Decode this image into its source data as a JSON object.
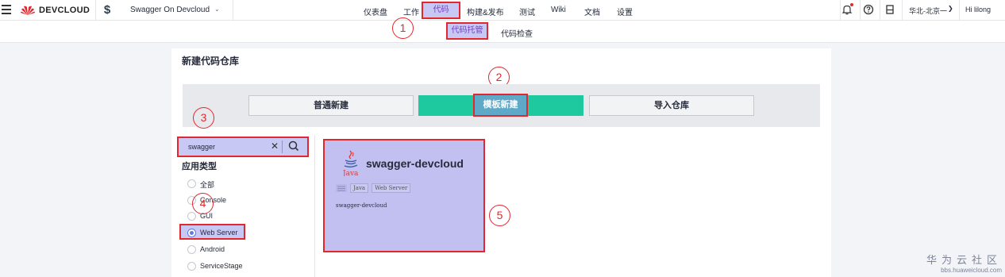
{
  "header": {
    "brand": "DEVCLOUD",
    "project": "Swagger On Devcloud",
    "nav": [
      "仪表盘",
      "工作",
      "代码",
      "构建&发布",
      "测试",
      "Wiki",
      "文档",
      "设置"
    ],
    "active_nav": "代码",
    "region": "华北-北京一",
    "user": "Hi lilong"
  },
  "subnav": {
    "active": "代码托管",
    "other": "代码检查"
  },
  "annotations": [
    "1",
    "2",
    "3",
    "4",
    "5"
  ],
  "page": {
    "title": "新建代码仓库",
    "tabs": [
      "普通新建",
      "模板新建",
      "导入仓库"
    ],
    "active_tab": "模板新建"
  },
  "filter": {
    "search_value": "swagger",
    "title": "应用类型",
    "options": [
      "全部",
      "Console",
      "GUI",
      "Web Server",
      "Android",
      "ServiceStage"
    ],
    "selected": "Web Server"
  },
  "template": {
    "logo_text": "Java",
    "name": "swagger-devcloud",
    "tags": [
      "Java",
      "Web Server"
    ],
    "description": "swagger-devcloud"
  },
  "watermark": {
    "line1": "华为云社区",
    "line2": "bbs.huaweicloud.com"
  },
  "colors": {
    "highlight_border": "#e0282e",
    "highlight_fill": "#c8c8f5",
    "green_tab": "#1ec9a0",
    "accent": "#5e7ce0"
  }
}
